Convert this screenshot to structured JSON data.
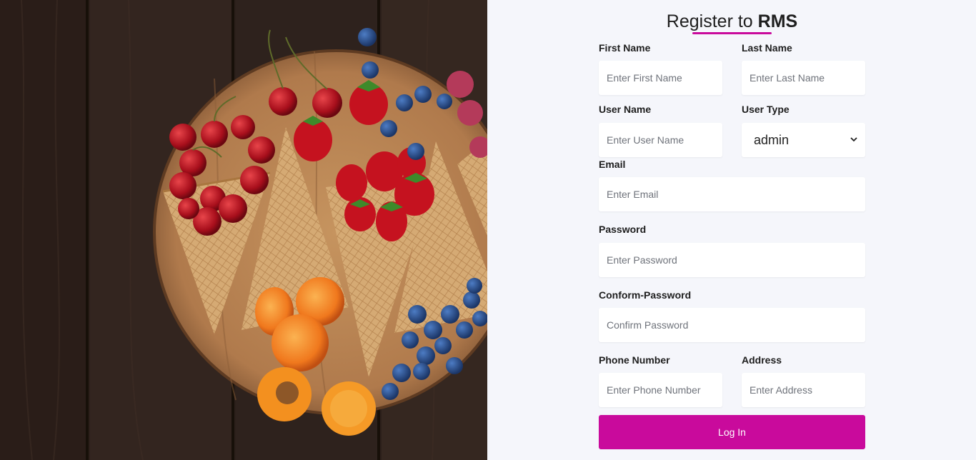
{
  "header": {
    "title_prefix": "Register to ",
    "title_brand": "RMS"
  },
  "form": {
    "first_name": {
      "label": "First Name",
      "placeholder": "Enter First Name"
    },
    "last_name": {
      "label": "Last Name",
      "placeholder": "Enter Last Name"
    },
    "user_name": {
      "label": "User Name",
      "placeholder": "Enter User Name"
    },
    "user_type": {
      "label": "User Type",
      "selected": "admin"
    },
    "email": {
      "label": "Email",
      "placeholder": "Enter Email"
    },
    "password": {
      "label": "Password",
      "placeholder": "Enter Password"
    },
    "confirm_password": {
      "label": "Conform-Password",
      "placeholder": "Confirm Password"
    },
    "phone": {
      "label": "Phone Number",
      "placeholder": "Enter Phone Number"
    },
    "address": {
      "label": "Address",
      "placeholder": "Enter Address"
    },
    "submit_label": "Log In"
  },
  "colors": {
    "accent": "#c90a9c",
    "panel_bg": "#f5f6fb",
    "wood_dark": "#2e211c",
    "board": "#b7855a"
  }
}
